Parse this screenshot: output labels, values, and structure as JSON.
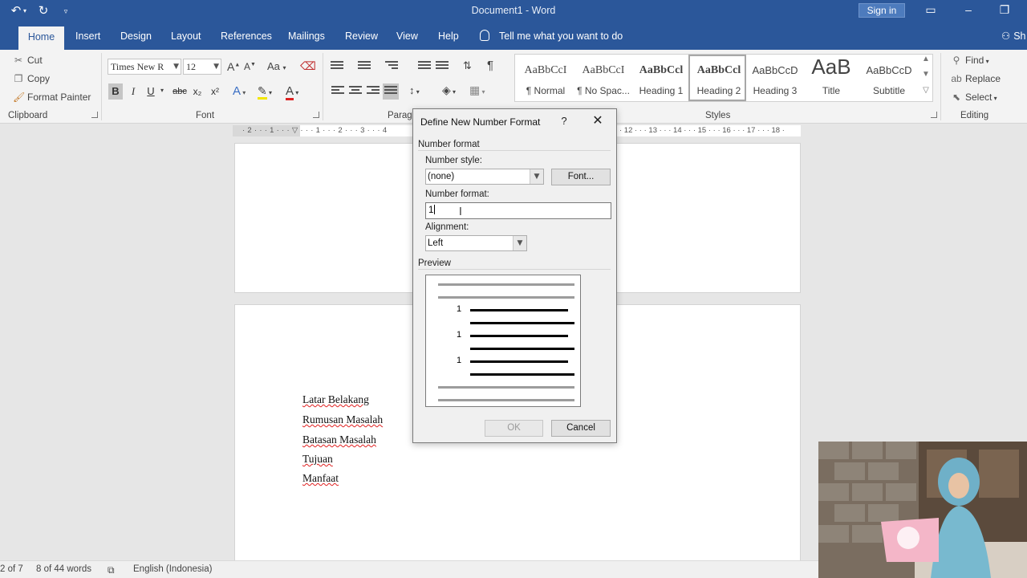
{
  "titlebar": {
    "document_title": "Document1 - Word",
    "signin_label": "Sign in",
    "undo_icon": "undo-icon",
    "redo_icon": "redo-icon"
  },
  "tabs": [
    {
      "label": "Home"
    },
    {
      "label": "Insert"
    },
    {
      "label": "Design"
    },
    {
      "label": "Layout"
    },
    {
      "label": "References"
    },
    {
      "label": "Mailings"
    },
    {
      "label": "Review"
    },
    {
      "label": "View"
    },
    {
      "label": "Help"
    }
  ],
  "tell_me": "Tell me what you want to do",
  "share": "Sh",
  "clipboard": {
    "cut": "Cut",
    "copy": "Copy",
    "format_painter": "Format Painter",
    "label": "Clipboard"
  },
  "font": {
    "name": "Times New R",
    "size": "12",
    "label": "Font",
    "bold": "B",
    "italic": "I",
    "underline": "U",
    "strike": "abc",
    "subscript": "x₂",
    "superscript": "x²",
    "case": "Aa",
    "grow": "A",
    "shrink": "A"
  },
  "paragraph": {
    "label": "Paragr"
  },
  "styles": {
    "label": "Styles",
    "items": [
      {
        "sample": "AaBbCcI",
        "name": "¶ Normal"
      },
      {
        "sample": "AaBbCcI",
        "name": "¶ No Spac..."
      },
      {
        "sample": "AaBbCcl",
        "name": "Heading 1"
      },
      {
        "sample": "AaBbCcl",
        "name": "Heading 2"
      },
      {
        "sample": "AaBbCcD",
        "name": "Heading 3"
      },
      {
        "sample": "AaB",
        "name": "Title"
      },
      {
        "sample": "AaBbCcD",
        "name": "Subtitle"
      }
    ]
  },
  "editing": {
    "find": "Find",
    "replace": "Replace",
    "select": "Select",
    "label": "Editing"
  },
  "ruler_text": "· 2 · · · 1 · · · ▽ · · · 1 · · · 2 · · · 3 · · · 4",
  "ruler_text_right": "· 12 · · · 13 · · · 14 · · · 15 · · · 16 · · · 17 · · · 18 ·",
  "document": {
    "lines": [
      "Latar Belakang",
      "Rumusan Masalah",
      "Batasan Masalah",
      "Tujuan",
      "Manfaat"
    ]
  },
  "status": {
    "page": "2 of 7",
    "words": "8 of 44 words",
    "language": "English (Indonesia)"
  },
  "dialog": {
    "title": "Define New Number Format",
    "help": "?",
    "section_number_format": "Number format",
    "number_style_label": "Number style:",
    "number_style_value": "(none)",
    "font_button": "Font...",
    "number_format_label": "Number format:",
    "number_format_value": "1",
    "alignment_label": "Alignment:",
    "alignment_value": "Left",
    "section_preview": "Preview",
    "preview_numbers": [
      "1",
      "1",
      "1"
    ],
    "ok": "OK",
    "cancel": "Cancel"
  },
  "colors": {
    "titlebar_blue": "#2b579a",
    "ribbon_bg": "#f3f3f3",
    "spell_underline": "#e02020"
  }
}
